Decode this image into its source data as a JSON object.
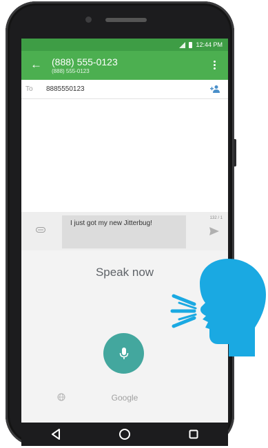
{
  "status_bar": {
    "time": "12:44 PM"
  },
  "conversation": {
    "contact_name": "(888) 555-0123",
    "contact_number": "(888) 555-0123"
  },
  "recipient": {
    "label": "To",
    "value": "8885550123"
  },
  "compose": {
    "message_text": "I just got my new Jitterbug!",
    "char_counter": "132 / 1"
  },
  "voice_input": {
    "prompt": "Speak now",
    "provider_label": "Google"
  },
  "colors": {
    "status_bar": "#3e9d45",
    "app_bar": "#4caf50",
    "mic_button": "#43a79e",
    "speaker_figure": "#1aa9e2"
  },
  "icons": [
    "back-arrow-icon",
    "overflow-menu-icon",
    "add-person-icon",
    "attach-icon",
    "send-icon",
    "microphone-icon",
    "globe-icon",
    "nav-back-icon",
    "nav-home-icon",
    "nav-recents-icon",
    "signal-icon",
    "battery-icon"
  ]
}
